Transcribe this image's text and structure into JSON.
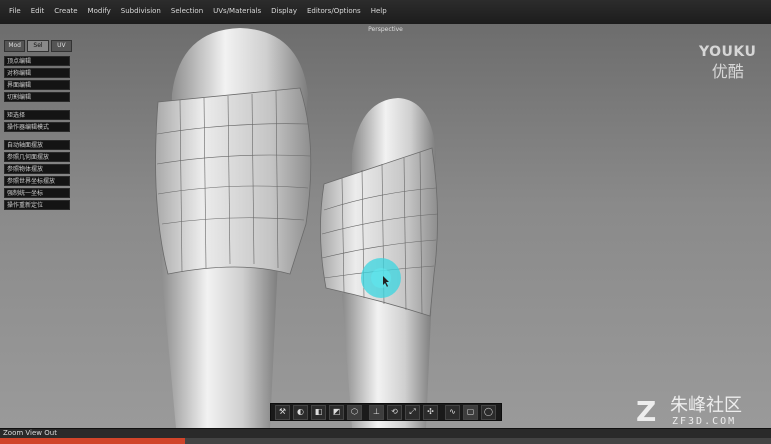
{
  "menu": [
    "File",
    "Edit",
    "Create",
    "Modify",
    "Subdivision",
    "Selection",
    "UVs/Materials",
    "Display",
    "Editors/Options",
    "Help"
  ],
  "viewport": {
    "label": "Perspective"
  },
  "watermark_youku": {
    "en": "YOUKU",
    "cn": "优酷"
  },
  "panel": {
    "tabs": [
      "Mod",
      "Sel",
      "UV"
    ],
    "group1": [
      "顶点编辑",
      "对称编辑",
      "界面编辑",
      "切割编辑"
    ],
    "group2": [
      "矩选择",
      "操作器编辑模式"
    ],
    "group3": [
      "自动轴面摆放",
      "参照几何面摆放",
      "参照物体摆放",
      "参照世界坐标摆放",
      "强制统一坐标",
      "操作重新定位"
    ]
  },
  "status": {
    "text": "Zoom View Out",
    "progress": 0.24
  },
  "watermark_zf": {
    "logo": "Z",
    "cn": "朱峰社区",
    "en": "ZF3D.COM"
  }
}
